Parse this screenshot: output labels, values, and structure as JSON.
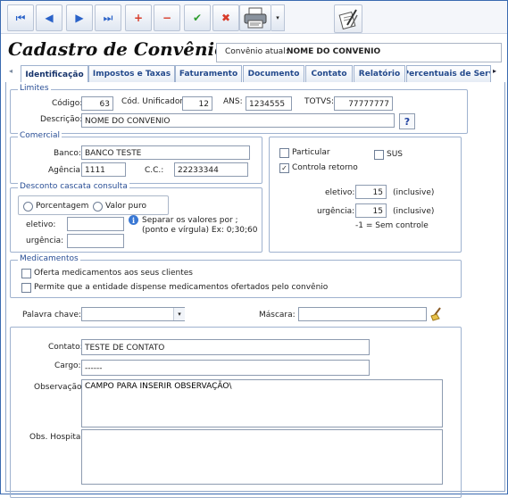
{
  "toolbar": {
    "buttons": [
      {
        "name": "first-record-button",
        "glyph": "⏮"
      },
      {
        "name": "prev-record-button",
        "glyph": "◀"
      },
      {
        "name": "next-record-button",
        "glyph": "▶"
      },
      {
        "name": "last-record-button",
        "glyph": "⏭"
      },
      {
        "name": "add-button",
        "glyph": "+"
      },
      {
        "name": "remove-button",
        "glyph": "−"
      },
      {
        "name": "confirm-button",
        "glyph": "✔"
      },
      {
        "name": "cancel-button",
        "glyph": "✖"
      }
    ],
    "printer_icon": "printer-icon",
    "dropdown_glyph": "▾",
    "tool_icon": "edit-tool-icon"
  },
  "header": {
    "title": "Cadastro de Convênios",
    "current_label": "Convênio atual:",
    "current_value": "NOME DO CONVENIO"
  },
  "tabs": {
    "left_arrow": "◂",
    "right_arrow": "▸",
    "items": [
      "Identificação",
      "Impostos e Taxas",
      "Faturamento",
      "Documento",
      "Contato",
      "Relatório",
      "Percentuais de Serv"
    ],
    "active": 0
  },
  "limites": {
    "legend": "Limites",
    "codigo_label": "Código:",
    "codigo": "63",
    "unificador_label": "Cód. Unificador:",
    "unificador": "12",
    "ans_label": "ANS:",
    "ans": "1234555",
    "totvs_label": "TOTVS:",
    "totvs": "77777777",
    "descricao_label": "Descrição:",
    "descricao": "NOME DO CONVENIO",
    "help_glyph": "?"
  },
  "comercial": {
    "legend": "Comercial",
    "banco_label": "Banco:",
    "banco": "BANCO TESTE",
    "agencia_label": "Agência:",
    "agencia": "1111",
    "cc_label": "C.C.:",
    "cc": "22233344"
  },
  "desconto": {
    "legend": "Desconto cascata consulta",
    "opt1": "Porcentagem",
    "opt2": "Valor puro",
    "eletivo_label": "eletivo:",
    "eletivo": "",
    "urgencia_label": "urgência:",
    "urgencia": "",
    "hint": "Separar os valores por ; (ponto e vírgula) Ex: 0;30;60"
  },
  "retorno": {
    "particular": "Particular",
    "particular_checked": false,
    "sus": "SUS",
    "sus_checked": false,
    "controla": "Controla retorno",
    "controla_checked": true,
    "eletivo_label": "eletivo:",
    "eletivo": "15",
    "eletivo_suffix": "(inclusive)",
    "urgencia_label": "urgência:",
    "urgencia": "15",
    "urgencia_suffix": "(inclusive)",
    "note": "-1 = Sem controle"
  },
  "medicamentos": {
    "legend": "Medicamentos",
    "opt1": "Oferta medicamentos aos seus clientes",
    "opt2": "Permite que a entidade dispense medicamentos ofertados pelo convênio"
  },
  "filtro": {
    "palavra_label": "Palavra chave:",
    "palavra": "",
    "mascara_label": "Máscara:",
    "mascara": ""
  },
  "contato": {
    "contato_label": "Contato:",
    "contato": "TESTE DE CONTATO",
    "cargo_label": "Cargo:",
    "cargo": "------",
    "obs_label": "Observação:",
    "obs": "CAMPO PARA INSERIR OBSERVAÇÃO\\",
    "obs_hosp_label": "Obs. Hospital:",
    "obs_hosp": ""
  }
}
